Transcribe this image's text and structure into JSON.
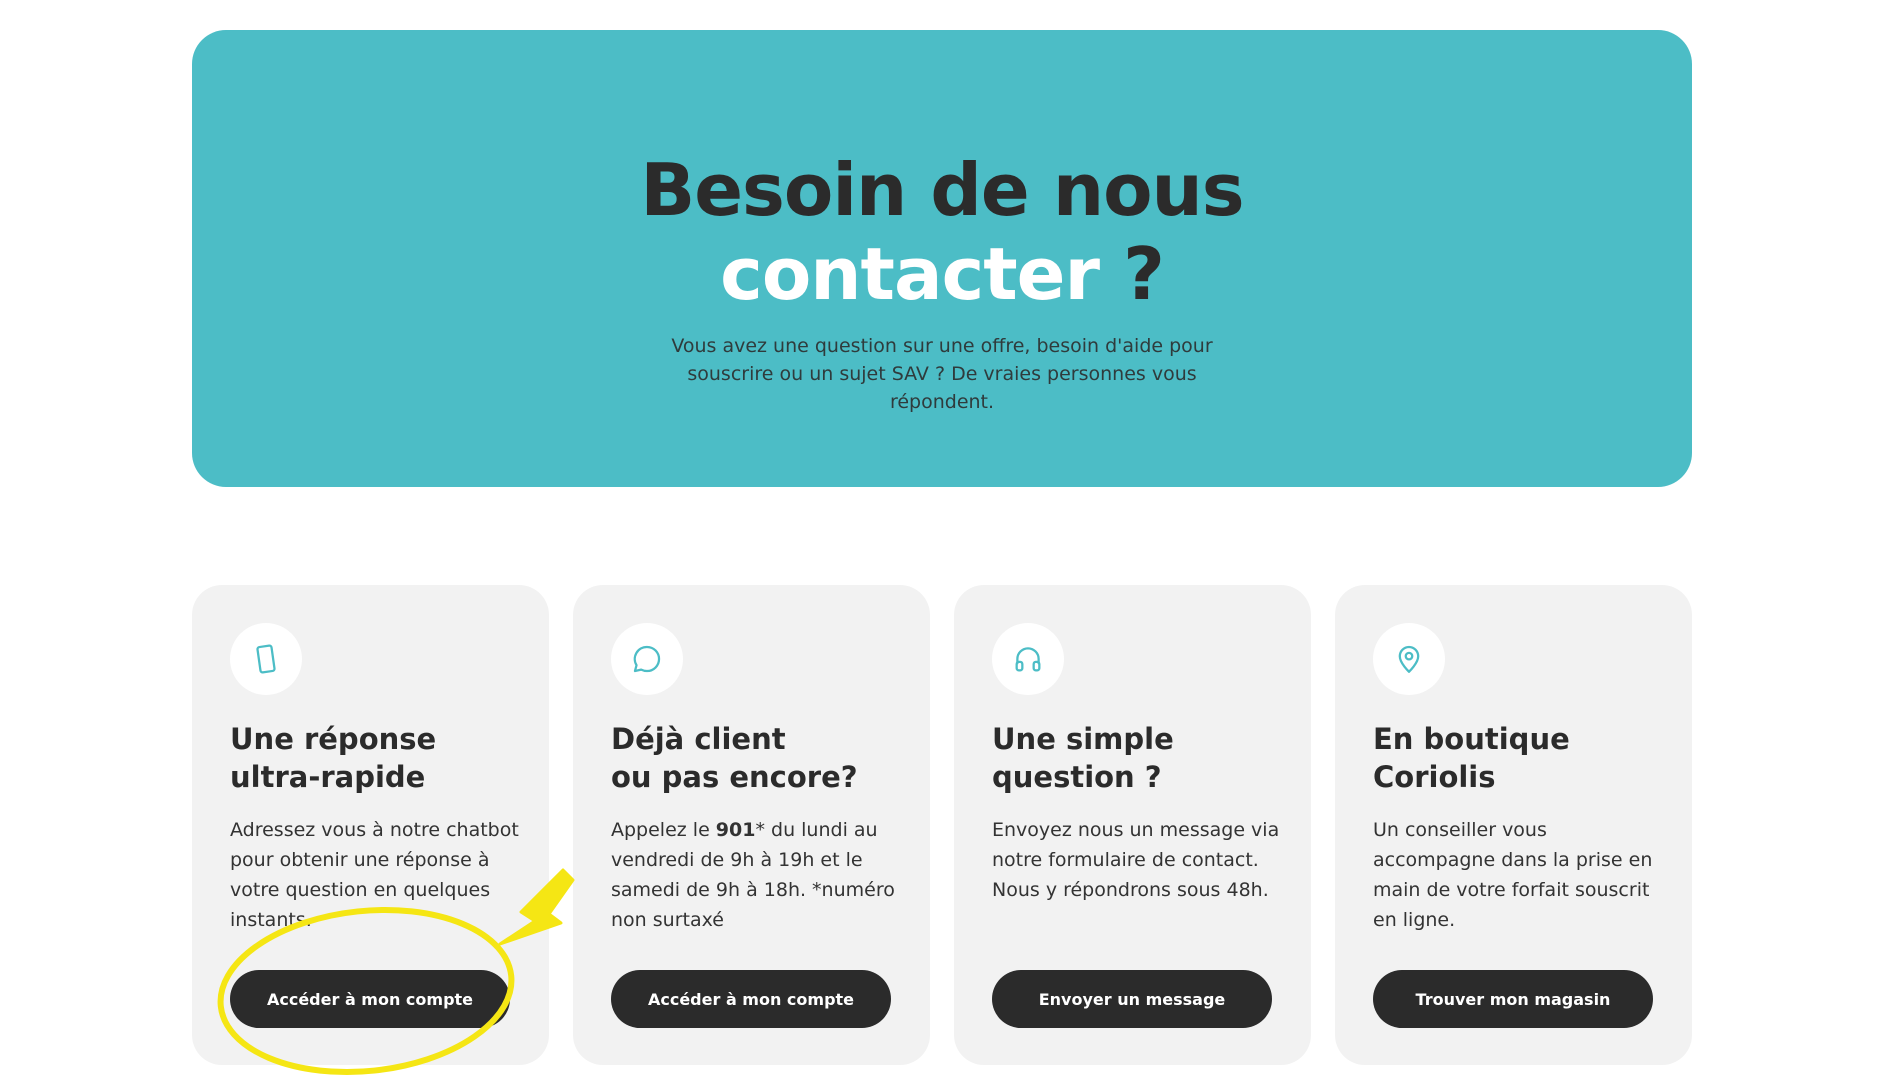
{
  "hero": {
    "title_line1": "Besoin de nous",
    "title_line2_word": "contacter",
    "title_line2_mark": " ?",
    "subtitle": "Vous avez une question sur une offre, besoin d'aide pour souscrire ou un sujet SAV ? De vraies personnes vous répondent.",
    "background_color": "#4cbdc6"
  },
  "cards": [
    {
      "icon": "smartphone-icon",
      "title": "Une réponse\nultra-rapide",
      "text": "Adressez vous à notre chatbot pour obtenir une réponse à votre question en quelques instants.",
      "button_label": "Accéder à mon compte"
    },
    {
      "icon": "chat-bubble-icon",
      "title": "Déjà client\nou pas encore?",
      "text_before": "Appelez le ",
      "text_bold": "901",
      "text_after": "* du lundi au vendredi de 9h à 19h et le samedi de 9h à 18h. *numéro non surtaxé",
      "button_label": "Accéder à mon compte"
    },
    {
      "icon": "headphones-icon",
      "title": "Une simple\nquestion ?",
      "text": "Envoyez nous un message via notre formulaire de contact. Nous y répondrons sous 48h.",
      "button_label": "Envoyer un message"
    },
    {
      "icon": "location-pin-icon",
      "title": "En boutique\nCoriolis",
      "text": "Un conseiller vous accompagne dans la prise en main de votre forfait souscrit en ligne.",
      "button_label": "Trouver mon magasin"
    }
  ],
  "colors": {
    "accent": "#4cbdc6",
    "card_bg": "#f2f2f2",
    "button_bg": "#2b2b2b",
    "annotation": "#f5e614"
  }
}
